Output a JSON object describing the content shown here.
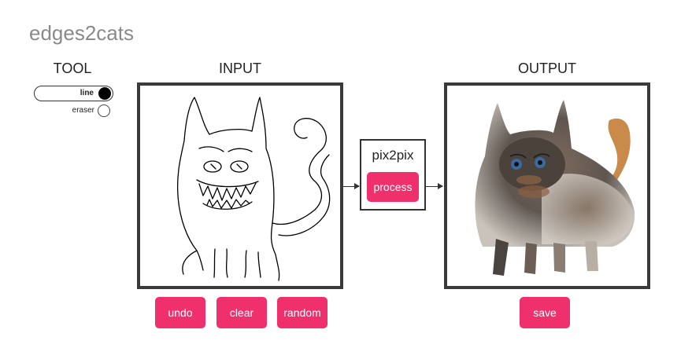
{
  "app": {
    "title": "edges2cats"
  },
  "tool": {
    "label": "TOOL",
    "options": [
      {
        "label": "line",
        "selected": true
      },
      {
        "label": "eraser",
        "selected": false
      }
    ]
  },
  "input": {
    "label": "INPUT"
  },
  "output": {
    "label": "OUTPUT"
  },
  "model": {
    "title": "pix2pix",
    "process_label": "process"
  },
  "actions": {
    "undo_label": "undo",
    "clear_label": "clear",
    "random_label": "random",
    "save_label": "save"
  },
  "colors": {
    "accent": "#f0306d",
    "title": "#8a8a8a",
    "border": "#3a3a3a"
  }
}
